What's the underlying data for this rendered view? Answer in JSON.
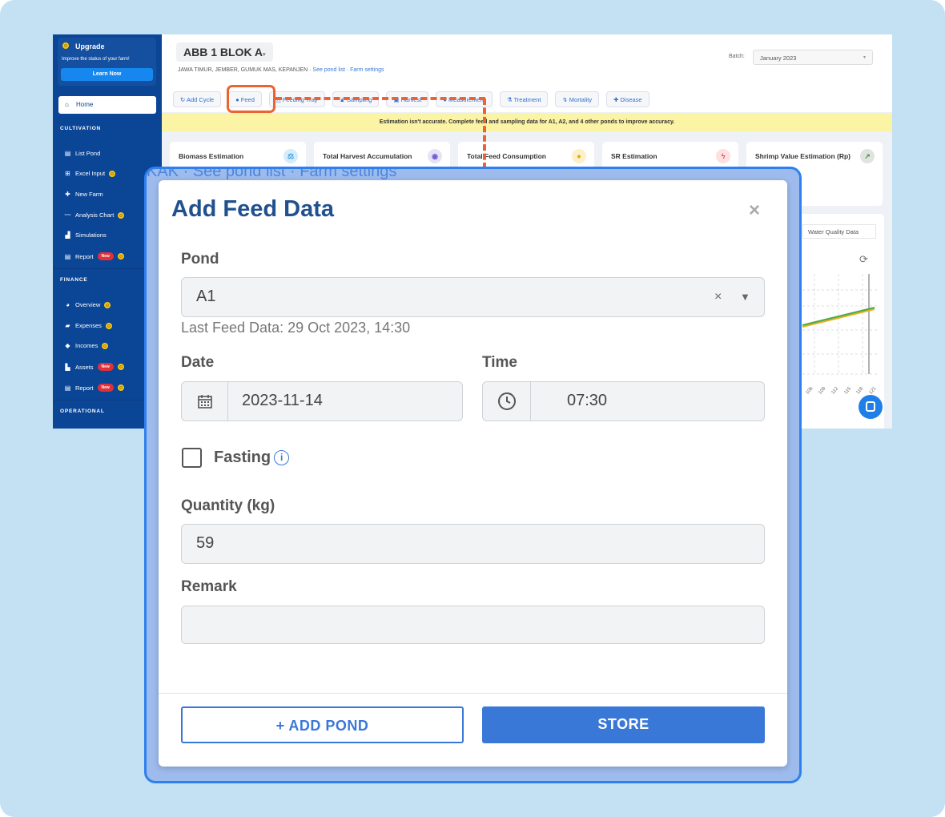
{
  "sidebar": {
    "upgrade_title": "Upgrade",
    "upgrade_sub": "Improve the status of your farm!",
    "learn_now": "Learn Now",
    "home": "Home",
    "sections": {
      "cultivation": "CULTIVATION",
      "finance": "FINANCE",
      "operational": "OPERATIONAL"
    },
    "cultivation": [
      {
        "label": "List Pond"
      },
      {
        "label": "Excel Input"
      },
      {
        "label": "New Farm"
      },
      {
        "label": "Analysis Chart"
      },
      {
        "label": "Simulations"
      },
      {
        "label": "Report"
      }
    ],
    "finance": [
      {
        "label": "Overview"
      },
      {
        "label": "Expenses"
      },
      {
        "label": "Incomes"
      },
      {
        "label": "Assets"
      },
      {
        "label": "Report"
      }
    ],
    "new_badge": "New"
  },
  "header": {
    "farm": "ABB 1 BLOK A",
    "location": "JAWA TIMUR, JEMBER, GUMUK MAS, KEPANJEN",
    "see_pond_list": "See pond list",
    "farm_settings": "Farm settings",
    "batch_label": "Batch:",
    "batch_value": "January 2023"
  },
  "actions": [
    "Add Cycle",
    "Feed",
    "Feeding Tray",
    "Sampling",
    "Harvest",
    "Measurement",
    "Treatment",
    "Mortality",
    "Disease"
  ],
  "warning": "Estimation isn't accurate. Complete feed and sampling data for A1, A2, and 4 other ponds to improve accuracy.",
  "cards": [
    "Biomass Estimation",
    "Total Harvest Accumulation",
    "Total Feed Consumption",
    "SR Estimation",
    "Shrimp Value Estimation (Rp)"
  ],
  "chart": {
    "tab": "Water Quality Data",
    "x_ticks": [
      "106",
      "109",
      "112",
      "115",
      "118",
      "121"
    ]
  },
  "ghost": {
    "subtitle": "KAK · See pond list · Farm settings"
  },
  "modal": {
    "title": "Add Feed Data",
    "close": "×",
    "pond_label": "Pond",
    "pond_value": "A1",
    "last_feed": "Last Feed Data: 29 Oct 2023, 14:30",
    "date_label": "Date",
    "date_value": "2023-11-14",
    "time_label": "Time",
    "time_value": "07:30",
    "fasting_label": "Fasting",
    "quantity_label": "Quantity (kg)",
    "quantity_value": "59",
    "remark_label": "Remark",
    "remark_value": "",
    "add_pond": "+ ADD POND",
    "store": "STORE"
  },
  "colors": {
    "accent": "#3a78d8",
    "sidebar": "#0b4596",
    "highlight": "#ee6231"
  }
}
